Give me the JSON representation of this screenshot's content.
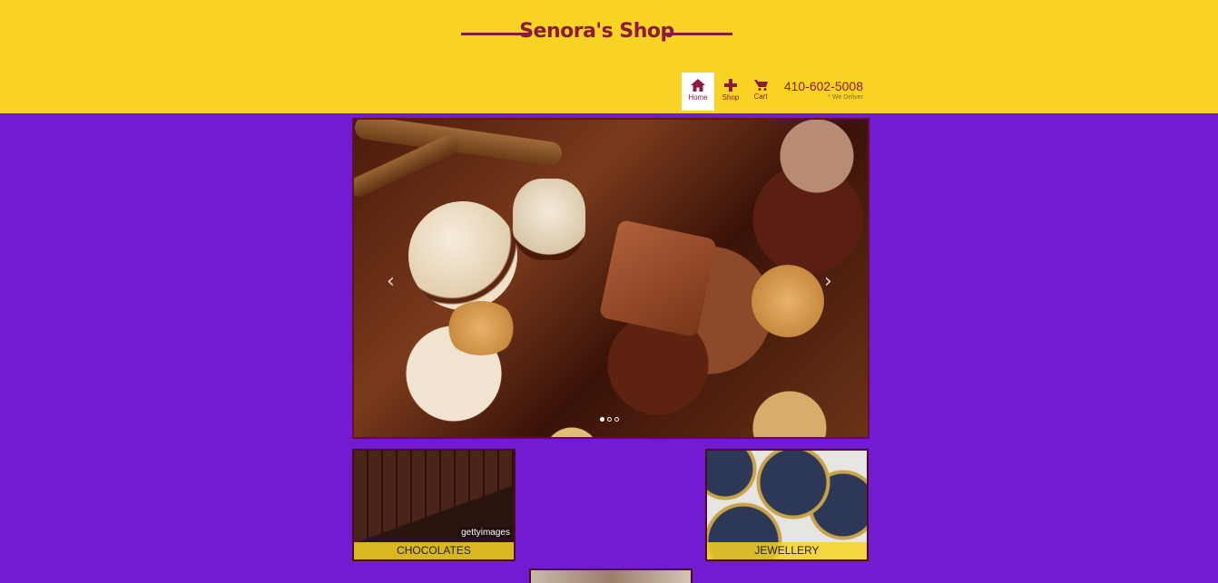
{
  "header": {
    "title": "Senora's Shop",
    "phone": "410-602-5008",
    "delivery_note": "* We Deliver"
  },
  "nav": {
    "items": [
      {
        "label": "Home",
        "icon": "home-icon",
        "active": true
      },
      {
        "label": "Shop",
        "icon": "plus-icon",
        "active": false
      },
      {
        "label": "Cart",
        "icon": "cart-icon",
        "active": false
      }
    ]
  },
  "carousel": {
    "slide_count": 3,
    "active_index": 0,
    "prev_label": "‹",
    "next_label": "›"
  },
  "categories": [
    {
      "label": "CHOCOLATES",
      "watermark": "gettyimages"
    },
    {
      "label": "JEWELLERY"
    },
    {
      "label": ""
    }
  ],
  "colors": {
    "header_bg": "#f8d323",
    "page_bg": "#731bd3",
    "accent": "#8c1a3c"
  }
}
